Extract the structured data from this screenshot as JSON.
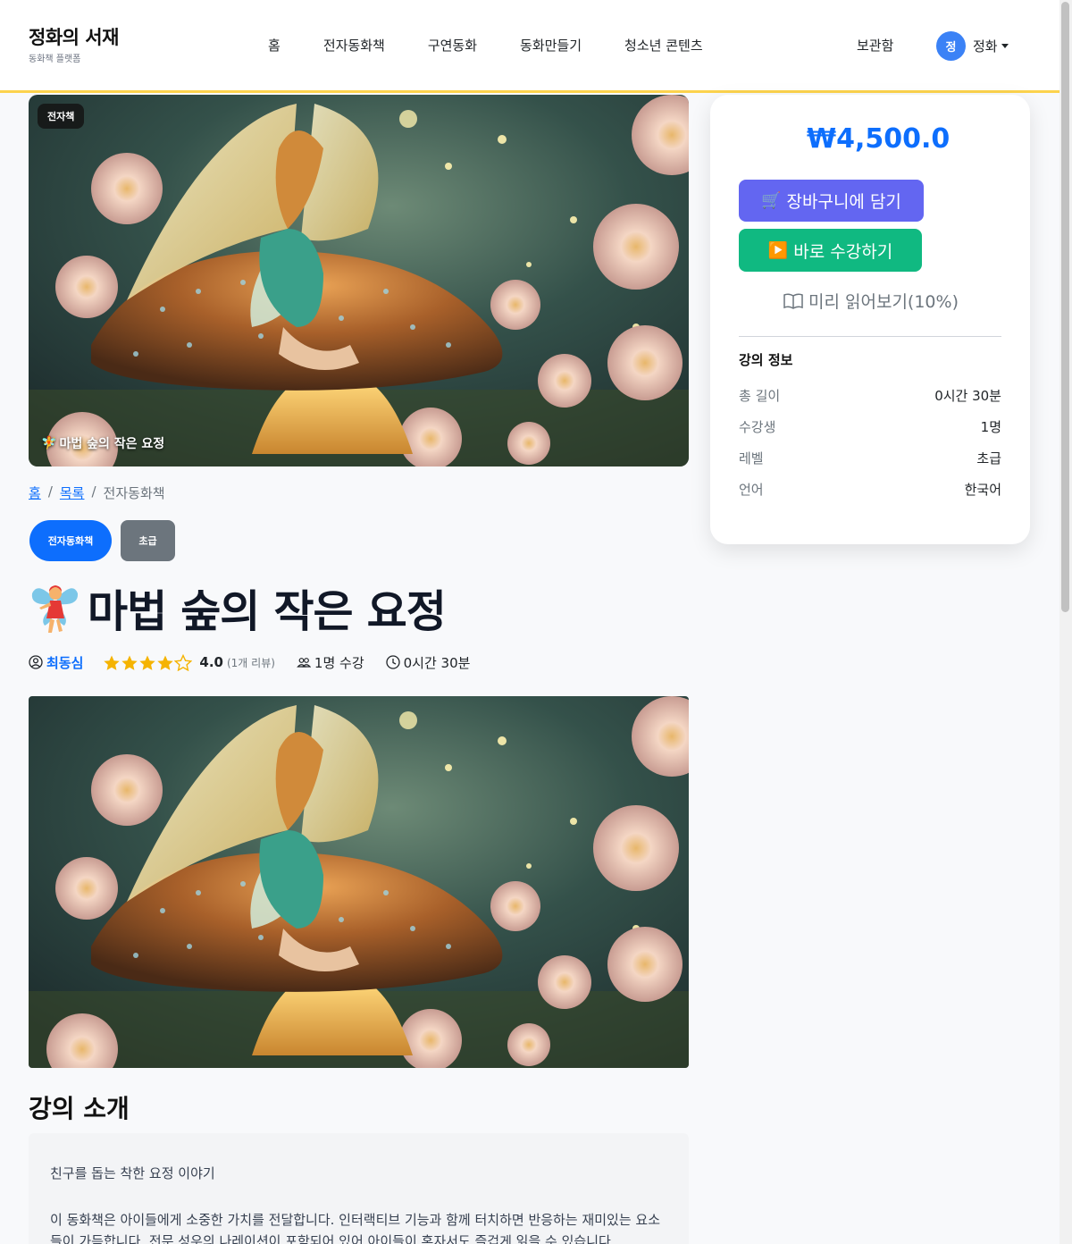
{
  "brand": {
    "title": "정화의 서재",
    "subtitle": "동화책 플랫폼"
  },
  "nav": {
    "links": [
      "홈",
      "전자동화책",
      "구연동화",
      "동화만들기",
      "청소년 콘텐츠"
    ],
    "archive": "보관함",
    "user": {
      "avatar_initial": "정",
      "name": "정화"
    }
  },
  "hero": {
    "badge": "전자책",
    "caption": "마법 숲의 작은 요정",
    "caption_emoji": "🧚"
  },
  "breadcrumb": {
    "home": "홈",
    "list": "목록",
    "current": "전자동화책"
  },
  "badges": {
    "category": "전자동화책",
    "level": "초급"
  },
  "course": {
    "title": "마법 숲의 작은 요정",
    "author": "최동심",
    "rating": "4.0",
    "rating_fraction": 0.8,
    "review_count": "(1개 리뷰)",
    "students": "1명 수강",
    "duration": "0시간 30분"
  },
  "intro": {
    "heading": "강의 소개",
    "p1": "친구를 돕는 착한 요정 이야기",
    "p2": "이 동화책은 아이들에게 소중한 가치를 전달합니다. 인터랙티브 기능과 함께 터치하면 반응하는 재미있는 요소들이 가득합니다. 전문 성우의 나레이션이 포함되어 있어 아이들이 혼자서도 즐겁게 읽을 수 있습니다."
  },
  "sidebar": {
    "price": "₩4,500.0",
    "cart_button": "장바구니에 담기",
    "cart_icon": "🛒",
    "enroll_button": "바로 수강하기",
    "enroll_icon": "▶️",
    "preview": "미리 읽어보기(10%)",
    "info_title": "강의 정보",
    "info": [
      {
        "key": "총 길이",
        "value": "0시간 30분"
      },
      {
        "key": "수강생",
        "value": "1명"
      },
      {
        "key": "레벨",
        "value": "초급"
      },
      {
        "key": "언어",
        "value": "한국어"
      }
    ]
  },
  "colors": {
    "accent": "#0d6efd",
    "cart": "#6366f1",
    "enroll": "#10b981",
    "star": "#f5b301",
    "nav_border": "#fcd34d"
  }
}
